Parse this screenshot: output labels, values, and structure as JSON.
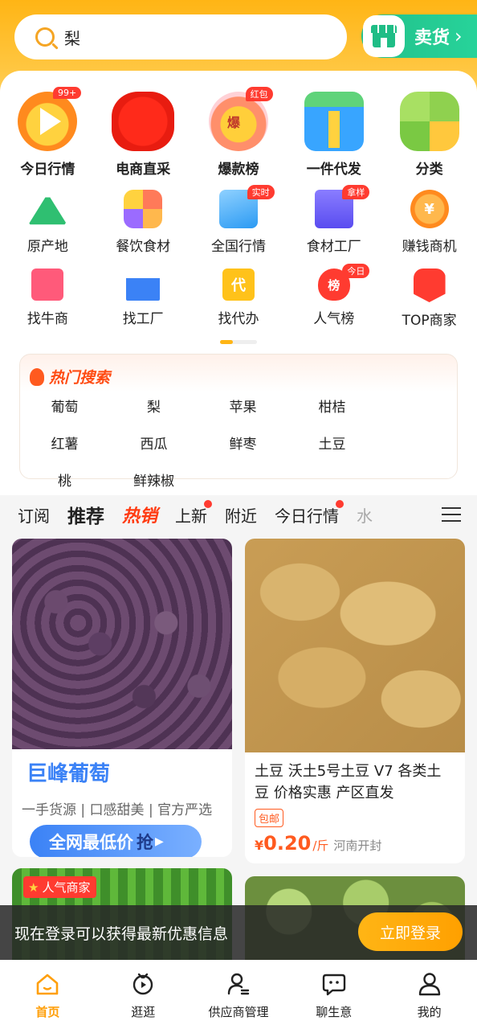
{
  "search": {
    "query": "梨"
  },
  "sell": {
    "label": "卖货",
    "chevron": "›"
  },
  "quick_entries": [
    {
      "label": "今日行情",
      "badge": "99+",
      "icon": "play-icon",
      "color": "#ff8a1e"
    },
    {
      "label": "电商直采",
      "badge": "",
      "icon": "badge-seal-icon",
      "color": "#ff3b30"
    },
    {
      "label": "爆款榜",
      "badge": "红包",
      "icon": "burst-medal-icon",
      "color": "#ff6b6b"
    },
    {
      "label": "一件代发",
      "badge": "",
      "icon": "box-icon",
      "color": "#2b9af3"
    },
    {
      "label": "分类",
      "badge": "",
      "icon": "category-icon",
      "color": "#7ac943"
    }
  ],
  "mid_entries": [
    {
      "label": "原产地",
      "badge": "",
      "icon": "mountain-icon",
      "color": "#2fbf71"
    },
    {
      "label": "餐饮食材",
      "badge": "",
      "icon": "food-icon",
      "color": "#ff8a4c"
    },
    {
      "label": "全国行情",
      "badge": "实时",
      "icon": "trend-icon",
      "color": "#2b9af3"
    },
    {
      "label": "食材工厂",
      "badge": "拿样",
      "icon": "factory-video-icon",
      "color": "#6a5cff"
    },
    {
      "label": "赚钱商机",
      "badge": "",
      "icon": "coin-icon",
      "color": "#ff9f0a"
    }
  ],
  "row3_entries": [
    {
      "label": "找牛商",
      "badge": "",
      "icon": "cow-icon",
      "color": "#ff5a7a"
    },
    {
      "label": "找工厂",
      "badge": "",
      "icon": "factory-icon",
      "color": "#3b82f6"
    },
    {
      "label": "找代办",
      "badge": "",
      "icon": "agent-icon",
      "color": "#ffb515"
    },
    {
      "label": "人气榜",
      "badge": "今日",
      "icon": "flame-rank-icon",
      "color": "#ff3b30"
    },
    {
      "label": "TOP商家",
      "badge": "",
      "icon": "crown-icon",
      "color": "#ff3b30"
    }
  ],
  "hot_search": {
    "title": "热门搜索",
    "items": [
      "葡萄",
      "梨",
      "苹果",
      "柑桔",
      "红薯",
      "西瓜",
      "鲜枣",
      "土豆",
      "桃",
      "鲜辣椒"
    ]
  },
  "tabs": [
    {
      "label": "订阅",
      "style": "normal",
      "dot": false
    },
    {
      "label": "推荐",
      "style": "active",
      "dot": false
    },
    {
      "label": "热销",
      "style": "hot",
      "dot": false
    },
    {
      "label": "上新",
      "style": "normal",
      "dot": true
    },
    {
      "label": "附近",
      "style": "normal",
      "dot": false
    },
    {
      "label": "今日行情",
      "style": "normal",
      "dot": true
    },
    {
      "label": "水",
      "style": "normal",
      "dot": false
    }
  ],
  "products": {
    "grapes": {
      "title": "巨峰葡萄",
      "subtitle": "一手货源 | 口感甜美 | 官方严选",
      "btn_main": "全网最低价",
      "btn_action": "抢"
    },
    "potato": {
      "title": "土豆 沃土5号土豆 V7 各类土豆 价格实惠 产区直发",
      "tag": "包邮",
      "price_symbol": "¥",
      "price": "0.20",
      "unit": "/斤",
      "origin": "河南开封"
    }
  },
  "popular_tag": "人气商家",
  "login": {
    "text": "现在登录可以获得最新优惠信息",
    "button": "立即登录"
  },
  "nav": [
    {
      "label": "首页",
      "icon": "home-icon",
      "active": true
    },
    {
      "label": "逛逛",
      "icon": "tv-icon",
      "active": false
    },
    {
      "label": "供应商管理",
      "icon": "supplier-icon",
      "active": false
    },
    {
      "label": "聊生意",
      "icon": "chat-icon",
      "active": false
    },
    {
      "label": "我的",
      "icon": "user-icon",
      "active": false
    }
  ]
}
